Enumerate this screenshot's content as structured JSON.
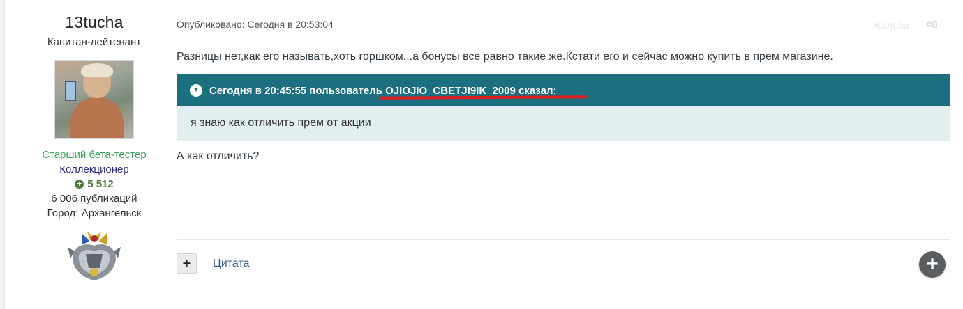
{
  "author": {
    "name": "13tucha",
    "rank": "Капитан-лейтенант",
    "group_primary": "Старший бета-тестер",
    "group_secondary": "Коллекционер",
    "reputation": "5 512",
    "posts": "6 006 публикаций",
    "city": "Город: Архангельск"
  },
  "post": {
    "published": "Опубликовано: Сегодня в 20:53:04",
    "report_label": "Жалоба",
    "number": "#8",
    "text_before_quote": "Разницы нет,как его называть,хоть горшком...а бонусы все равно такие же.Кстати его и сейчас можно купить в прем магазине.",
    "quote": {
      "header": "Сегодня в 20:45:55 пользователь OJIOJIO_CBETJI9IK_2009 сказал:",
      "body": "я знаю как отличить прем от акции"
    },
    "text_after_quote": "А как отличить?"
  },
  "actions": {
    "multiquote_symbol": "+",
    "quote_label": "Цитата",
    "fab_symbol": "+"
  },
  "colors": {
    "quote_header": "#1b6f7e",
    "quote_body": "#e2efef",
    "underline": "#e11b1b",
    "group_primary": "#3aa35b",
    "group_secondary": "#2a2a88"
  }
}
